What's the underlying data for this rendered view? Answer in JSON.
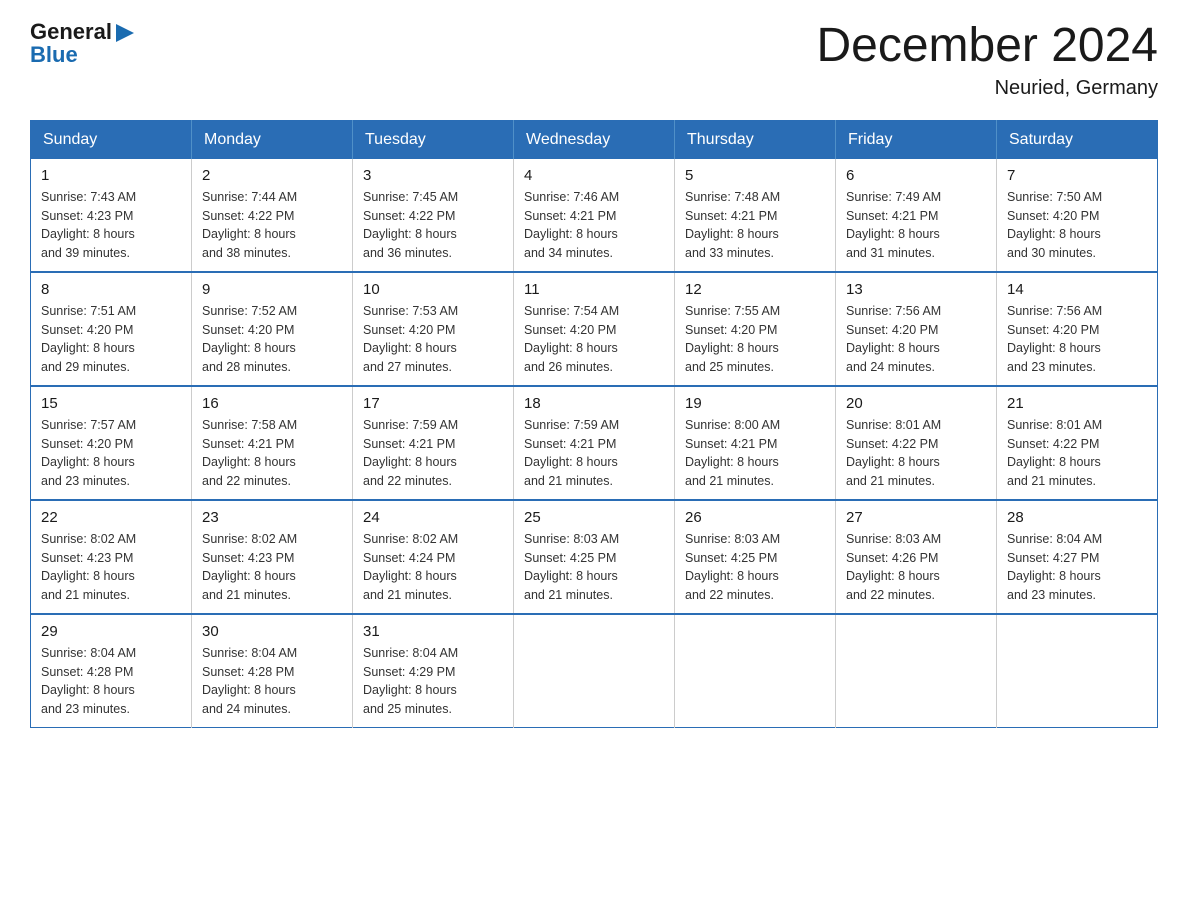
{
  "header": {
    "logo": {
      "text_general": "General",
      "text_blue": "Blue",
      "arrow": "▶"
    },
    "title": "December 2024",
    "subtitle": "Neuried, Germany"
  },
  "calendar": {
    "weekdays": [
      "Sunday",
      "Monday",
      "Tuesday",
      "Wednesday",
      "Thursday",
      "Friday",
      "Saturday"
    ],
    "weeks": [
      [
        {
          "day": "1",
          "sunrise": "7:43 AM",
          "sunset": "4:23 PM",
          "daylight": "8 hours and 39 minutes."
        },
        {
          "day": "2",
          "sunrise": "7:44 AM",
          "sunset": "4:22 PM",
          "daylight": "8 hours and 38 minutes."
        },
        {
          "day": "3",
          "sunrise": "7:45 AM",
          "sunset": "4:22 PM",
          "daylight": "8 hours and 36 minutes."
        },
        {
          "day": "4",
          "sunrise": "7:46 AM",
          "sunset": "4:21 PM",
          "daylight": "8 hours and 34 minutes."
        },
        {
          "day": "5",
          "sunrise": "7:48 AM",
          "sunset": "4:21 PM",
          "daylight": "8 hours and 33 minutes."
        },
        {
          "day": "6",
          "sunrise": "7:49 AM",
          "sunset": "4:21 PM",
          "daylight": "8 hours and 31 minutes."
        },
        {
          "day": "7",
          "sunrise": "7:50 AM",
          "sunset": "4:20 PM",
          "daylight": "8 hours and 30 minutes."
        }
      ],
      [
        {
          "day": "8",
          "sunrise": "7:51 AM",
          "sunset": "4:20 PM",
          "daylight": "8 hours and 29 minutes."
        },
        {
          "day": "9",
          "sunrise": "7:52 AM",
          "sunset": "4:20 PM",
          "daylight": "8 hours and 28 minutes."
        },
        {
          "day": "10",
          "sunrise": "7:53 AM",
          "sunset": "4:20 PM",
          "daylight": "8 hours and 27 minutes."
        },
        {
          "day": "11",
          "sunrise": "7:54 AM",
          "sunset": "4:20 PM",
          "daylight": "8 hours and 26 minutes."
        },
        {
          "day": "12",
          "sunrise": "7:55 AM",
          "sunset": "4:20 PM",
          "daylight": "8 hours and 25 minutes."
        },
        {
          "day": "13",
          "sunrise": "7:56 AM",
          "sunset": "4:20 PM",
          "daylight": "8 hours and 24 minutes."
        },
        {
          "day": "14",
          "sunrise": "7:56 AM",
          "sunset": "4:20 PM",
          "daylight": "8 hours and 23 minutes."
        }
      ],
      [
        {
          "day": "15",
          "sunrise": "7:57 AM",
          "sunset": "4:20 PM",
          "daylight": "8 hours and 23 minutes."
        },
        {
          "day": "16",
          "sunrise": "7:58 AM",
          "sunset": "4:21 PM",
          "daylight": "8 hours and 22 minutes."
        },
        {
          "day": "17",
          "sunrise": "7:59 AM",
          "sunset": "4:21 PM",
          "daylight": "8 hours and 22 minutes."
        },
        {
          "day": "18",
          "sunrise": "7:59 AM",
          "sunset": "4:21 PM",
          "daylight": "8 hours and 21 minutes."
        },
        {
          "day": "19",
          "sunrise": "8:00 AM",
          "sunset": "4:21 PM",
          "daylight": "8 hours and 21 minutes."
        },
        {
          "day": "20",
          "sunrise": "8:01 AM",
          "sunset": "4:22 PM",
          "daylight": "8 hours and 21 minutes."
        },
        {
          "day": "21",
          "sunrise": "8:01 AM",
          "sunset": "4:22 PM",
          "daylight": "8 hours and 21 minutes."
        }
      ],
      [
        {
          "day": "22",
          "sunrise": "8:02 AM",
          "sunset": "4:23 PM",
          "daylight": "8 hours and 21 minutes."
        },
        {
          "day": "23",
          "sunrise": "8:02 AM",
          "sunset": "4:23 PM",
          "daylight": "8 hours and 21 minutes."
        },
        {
          "day": "24",
          "sunrise": "8:02 AM",
          "sunset": "4:24 PM",
          "daylight": "8 hours and 21 minutes."
        },
        {
          "day": "25",
          "sunrise": "8:03 AM",
          "sunset": "4:25 PM",
          "daylight": "8 hours and 21 minutes."
        },
        {
          "day": "26",
          "sunrise": "8:03 AM",
          "sunset": "4:25 PM",
          "daylight": "8 hours and 22 minutes."
        },
        {
          "day": "27",
          "sunrise": "8:03 AM",
          "sunset": "4:26 PM",
          "daylight": "8 hours and 22 minutes."
        },
        {
          "day": "28",
          "sunrise": "8:04 AM",
          "sunset": "4:27 PM",
          "daylight": "8 hours and 23 minutes."
        }
      ],
      [
        {
          "day": "29",
          "sunrise": "8:04 AM",
          "sunset": "4:28 PM",
          "daylight": "8 hours and 23 minutes."
        },
        {
          "day": "30",
          "sunrise": "8:04 AM",
          "sunset": "4:28 PM",
          "daylight": "8 hours and 24 minutes."
        },
        {
          "day": "31",
          "sunrise": "8:04 AM",
          "sunset": "4:29 PM",
          "daylight": "8 hours and 25 minutes."
        },
        null,
        null,
        null,
        null
      ]
    ],
    "labels": {
      "sunrise": "Sunrise:",
      "sunset": "Sunset:",
      "daylight": "Daylight:"
    }
  }
}
